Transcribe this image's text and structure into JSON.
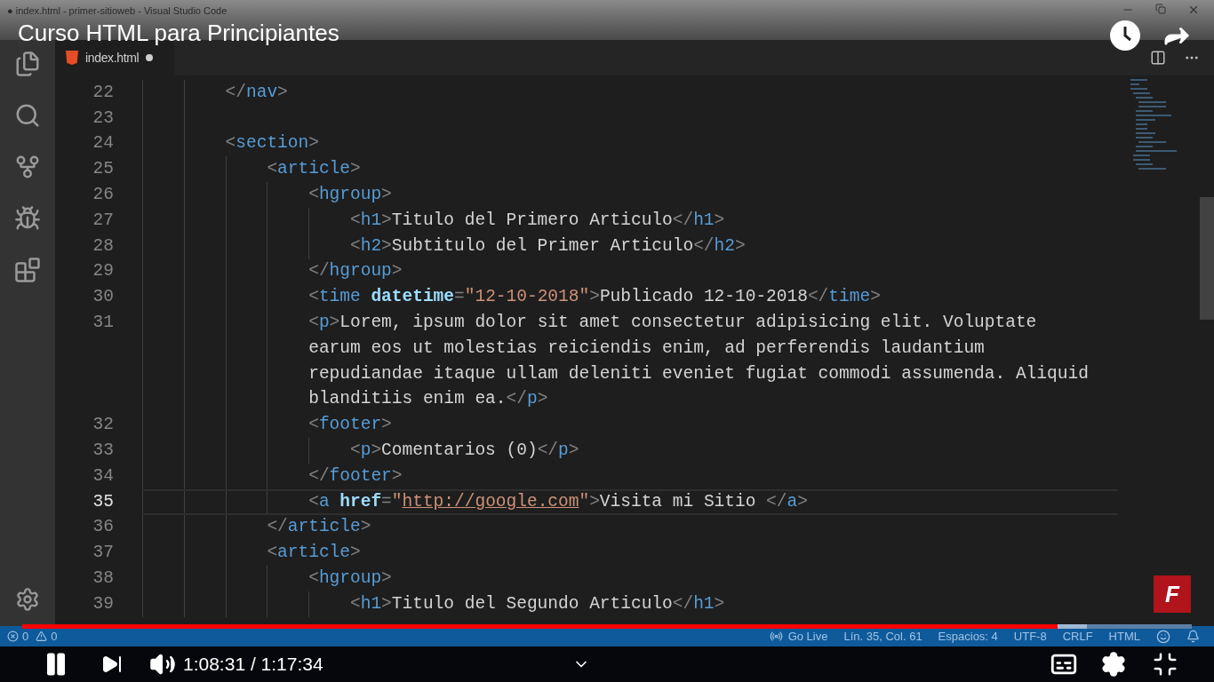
{
  "window": {
    "title": "● index.html - primer-sitioweb - Visual Studio Code"
  },
  "video_title": "Curso HTML para Principiantes",
  "tab": {
    "label": "index.html",
    "modified": true
  },
  "code_lines": [
    {
      "number": "22",
      "current": false,
      "tokens": [
        {
          "kind": "punct",
          "text": "</"
        },
        {
          "kind": "tag",
          "text": "nav"
        },
        {
          "kind": "punct",
          "text": ">"
        }
      ]
    },
    {
      "number": "23",
      "current": false
    },
    {
      "number": "24",
      "current": false,
      "tokens": [
        {
          "kind": "punct",
          "text": "<"
        },
        {
          "kind": "tag",
          "text": "section"
        },
        {
          "kind": "punct",
          "text": ">"
        }
      ],
      "children": [
        {
          "number": "25",
          "current": false,
          "tokens": [
            {
              "kind": "punct",
              "text": "<"
            },
            {
              "kind": "tag",
              "text": "article"
            },
            {
              "kind": "punct",
              "text": ">"
            }
          ],
          "children": [
            {
              "number": "26",
              "current": false,
              "tokens": [
                {
                  "kind": "punct",
                  "text": "<"
                },
                {
                  "kind": "tag",
                  "text": "hgroup"
                },
                {
                  "kind": "punct",
                  "text": ">"
                }
              ],
              "children": [
                {
                  "number": "27",
                  "current": false,
                  "tokens": [
                    {
                      "kind": "punct",
                      "text": "<"
                    },
                    {
                      "kind": "tag",
                      "text": "h1"
                    },
                    {
                      "kind": "punct",
                      "text": ">"
                    },
                    {
                      "kind": "text",
                      "text": "Titulo del Primero Articulo"
                    },
                    {
                      "kind": "punct",
                      "text": "</"
                    },
                    {
                      "kind": "tag",
                      "text": "h1"
                    },
                    {
                      "kind": "punct",
                      "text": ">"
                    }
                  ]
                },
                {
                  "number": "28",
                  "current": false,
                  "tokens": [
                    {
                      "kind": "punct",
                      "text": "<"
                    },
                    {
                      "kind": "tag",
                      "text": "h2"
                    },
                    {
                      "kind": "punct",
                      "text": ">"
                    },
                    {
                      "kind": "text",
                      "text": "Subtitulo del Primer Articulo"
                    },
                    {
                      "kind": "punct",
                      "text": "</"
                    },
                    {
                      "kind": "tag",
                      "text": "h2"
                    },
                    {
                      "kind": "punct",
                      "text": ">"
                    }
                  ]
                }
              ]
            },
            {
              "number": "29",
              "current": false,
              "tokens": [
                {
                  "kind": "punct",
                  "text": "</"
                },
                {
                  "kind": "tag",
                  "text": "hgroup"
                },
                {
                  "kind": "punct",
                  "text": ">"
                }
              ]
            },
            {
              "number": "30",
              "current": false,
              "tokens": [
                {
                  "kind": "punct",
                  "text": "<"
                },
                {
                  "kind": "tag",
                  "text": "time"
                },
                {
                  "kind": "attr",
                  "text": " datetime"
                },
                {
                  "kind": "punct",
                  "text": "="
                },
                {
                  "kind": "string",
                  "text": "\"12-10-2018\""
                },
                {
                  "kind": "punct",
                  "text": ">"
                },
                {
                  "kind": "text",
                  "text": "Publicado 12-10-2018"
                },
                {
                  "kind": "punct",
                  "text": "</"
                },
                {
                  "kind": "tag",
                  "text": "time"
                },
                {
                  "kind": "punct",
                  "text": ">"
                }
              ]
            },
            {
              "number": "31",
              "current": false,
              "tokens": [
                {
                  "kind": "punct",
                  "text": "<"
                },
                {
                  "kind": "tag",
                  "text": "p"
                },
                {
                  "kind": "punct",
                  "text": ">"
                },
                {
                  "kind": "text",
                  "text": "Lorem, ipsum dolor sit amet consectetur adipisicing elit. Voluptate"
                }
              ],
              "wrapped": [
                {
                  "tokens": [
                    {
                      "kind": "text",
                      "text": "earum eos ut molestias reiciendis enim, ad perferendis laudantium"
                    }
                  ]
                },
                {
                  "tokens": [
                    {
                      "kind": "text",
                      "text": "repudiandae itaque ullam deleniti eveniet fugiat commodi assumenda. Aliquid"
                    }
                  ]
                },
                {
                  "tokens": [
                    {
                      "kind": "text",
                      "text": "blanditiis enim ea."
                    },
                    {
                      "kind": "punct",
                      "text": "</"
                    },
                    {
                      "kind": "tag",
                      "text": "p"
                    },
                    {
                      "kind": "punct",
                      "text": ">"
                    }
                  ]
                }
              ]
            },
            {
              "number": "32",
              "current": false,
              "tokens": [
                {
                  "kind": "punct",
                  "text": "<"
                },
                {
                  "kind": "tag",
                  "text": "footer"
                },
                {
                  "kind": "punct",
                  "text": ">"
                }
              ],
              "children": [
                {
                  "number": "33",
                  "current": false,
                  "tokens": [
                    {
                      "kind": "punct",
                      "text": "<"
                    },
                    {
                      "kind": "tag",
                      "text": "p"
                    },
                    {
                      "kind": "punct",
                      "text": ">"
                    },
                    {
                      "kind": "text",
                      "text": "Comentarios (0)"
                    },
                    {
                      "kind": "punct",
                      "text": "</"
                    },
                    {
                      "kind": "tag",
                      "text": "p"
                    },
                    {
                      "kind": "punct",
                      "text": ">"
                    }
                  ]
                }
              ]
            },
            {
              "number": "34",
              "current": false,
              "tokens": [
                {
                  "kind": "punct",
                  "text": "</"
                },
                {
                  "kind": "tag",
                  "text": "footer"
                },
                {
                  "kind": "punct",
                  "text": ">"
                }
              ]
            },
            {
              "number": "35",
              "current": true,
              "tokens": [
                {
                  "kind": "punct",
                  "text": "<"
                },
                {
                  "kind": "tag",
                  "text": "a"
                },
                {
                  "kind": "attr",
                  "text": " href"
                },
                {
                  "kind": "punct",
                  "text": "="
                },
                {
                  "kind": "string",
                  "text": "\""
                },
                {
                  "kind": "link",
                  "text": "http://google.com"
                },
                {
                  "kind": "string",
                  "text": "\""
                },
                {
                  "kind": "punct",
                  "text": ">"
                },
                {
                  "kind": "text",
                  "text": "Visita mi Sitio "
                },
                {
                  "kind": "punct",
                  "text": "</"
                },
                {
                  "kind": "tag",
                  "text": "a"
                },
                {
                  "kind": "punct",
                  "text": ">"
                }
              ]
            }
          ]
        },
        {
          "number": "36",
          "current": false,
          "tokens": [
            {
              "kind": "punct",
              "text": "</"
            },
            {
              "kind": "tag",
              "text": "article"
            },
            {
              "kind": "punct",
              "text": ">"
            }
          ]
        },
        {
          "number": "37",
          "current": false,
          "tokens": [
            {
              "kind": "punct",
              "text": "<"
            },
            {
              "kind": "tag",
              "text": "article"
            },
            {
              "kind": "punct",
              "text": ">"
            }
          ],
          "children": [
            {
              "number": "38",
              "current": false,
              "tokens": [
                {
                  "kind": "punct",
                  "text": "<"
                },
                {
                  "kind": "tag",
                  "text": "hgroup"
                },
                {
                  "kind": "punct",
                  "text": ">"
                }
              ],
              "children": [
                {
                  "number": "39",
                  "current": false,
                  "tokens": [
                    {
                      "kind": "punct",
                      "text": "<"
                    },
                    {
                      "kind": "tag",
                      "text": "h1"
                    },
                    {
                      "kind": "punct",
                      "text": ">"
                    },
                    {
                      "kind": "text",
                      "text": "Titulo del Segundo Articulo"
                    },
                    {
                      "kind": "punct",
                      "text": "</"
                    },
                    {
                      "kind": "tag",
                      "text": "h1"
                    },
                    {
                      "kind": "punct",
                      "text": ">"
                    }
                  ]
                }
              ]
            }
          ]
        }
      ]
    }
  ],
  "status_bar": {
    "errors": "0",
    "warnings": "0",
    "items": [
      "Go Live",
      "Lín. 35, Col. 61",
      "Espacios: 4",
      "UTF-8",
      "CRLF",
      "HTML"
    ]
  },
  "player": {
    "playing": true,
    "progress": {
      "level": 0.885
    },
    "buffered": {
      "level": 0.91
    },
    "time": "1:08:31 / 1:17:34"
  },
  "channel_logo": "F"
}
